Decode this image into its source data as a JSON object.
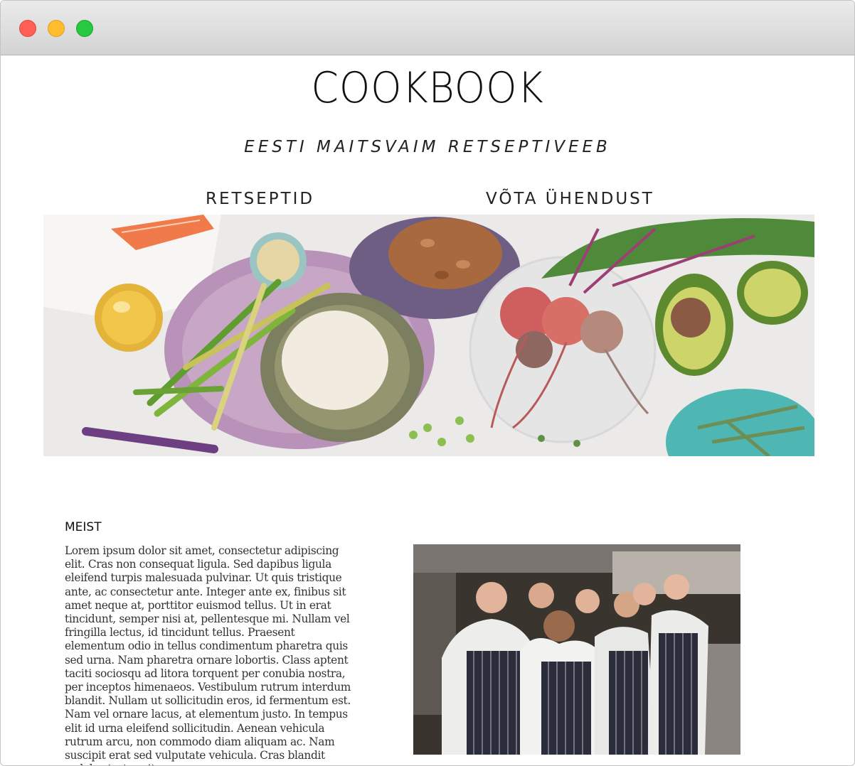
{
  "site": {
    "title": "COOKBOOK",
    "tagline": "EESTI MAITSVAIM RETSEPTIVEEB"
  },
  "nav": {
    "recipes": "RETSEPTID",
    "contact": "VÕTA ÜHENDUST"
  },
  "about": {
    "heading": "MEIST",
    "text": "Lorem ipsum dolor sit amet, consectetur adipiscing elit. Cras non consequat ligula. Sed dapibus ligula eleifend turpis malesuada pulvinar. Ut quis tristique ante, ac consectetur ante. Integer ante ex, finibus sit amet neque at, porttitor euismod tellus. Ut in erat tincidunt, semper nisi at, pellentesque mi. Nullam vel fringilla lectus, id tincidunt tellus. Praesent elementum odio in tellus condimentum pharetra quis sed urna. Nam pharetra ornare lobortis. Class aptent taciti sociosqu ad litora torquent per conubia nostra, per inceptos himenaeos. Vestibulum rutrum interdum blandit. Nullam ut sollicitudin eros, id fermentum est. Nam vel ornare lacus, at elementum justo. In tempus elit id urna eleifend sollicitudin. Aenean vehicula rutrum arcu, non commodo diam aliquam ac. Nam suscipit erat sed vulputate vehicula. Cras blandit sodales tortor vitae"
  },
  "colors": {
    "close": "#ff5f57",
    "minimize": "#febc2e",
    "maximize": "#28c840"
  }
}
